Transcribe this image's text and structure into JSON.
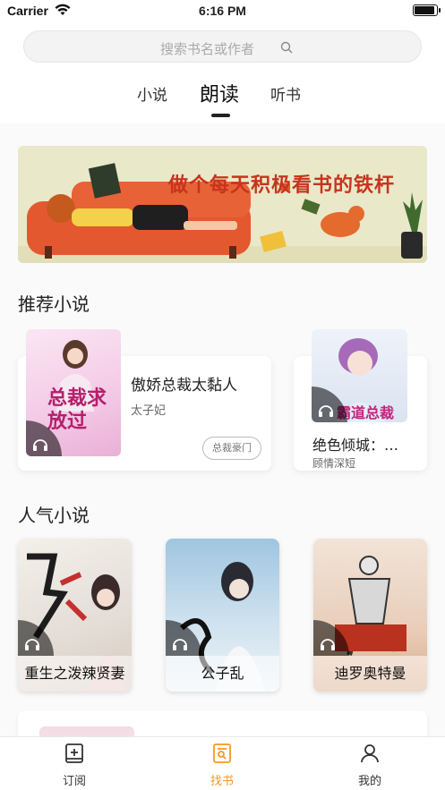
{
  "status_bar": {
    "carrier": "Carrier",
    "time": "6:16 PM"
  },
  "search": {
    "placeholder": "搜索书名或作者"
  },
  "top_tabs": [
    {
      "label": "小说",
      "active": false
    },
    {
      "label": "朗读",
      "active": true
    },
    {
      "label": "听书",
      "active": false
    }
  ],
  "banner": {
    "text": "做个每天积极看书的铁杆"
  },
  "recommended": {
    "title": "推荐小说",
    "items": [
      {
        "title": "傲娇总裁太黏人",
        "author": "太子妃",
        "tag": "总裁豪门",
        "cover_text": "总裁求放过"
      },
      {
        "title": "绝色倾城：…",
        "author": "顾情深短",
        "cover_text": "霸道总裁"
      }
    ]
  },
  "popular": {
    "title": "人气小说",
    "items": [
      {
        "title": "重生之泼辣贤妻"
      },
      {
        "title": "公子乱"
      },
      {
        "title": "迪罗奥特曼"
      }
    ]
  },
  "tabbar": [
    {
      "label": "订阅",
      "icon": "subscribe-icon",
      "active": false
    },
    {
      "label": "找书",
      "icon": "find-book-icon",
      "active": true
    },
    {
      "label": "我的",
      "icon": "profile-icon",
      "active": false
    }
  ],
  "colors": {
    "accent": "#f59a23",
    "banner_text": "#c7341d",
    "highlight": "#fbe3c3"
  }
}
